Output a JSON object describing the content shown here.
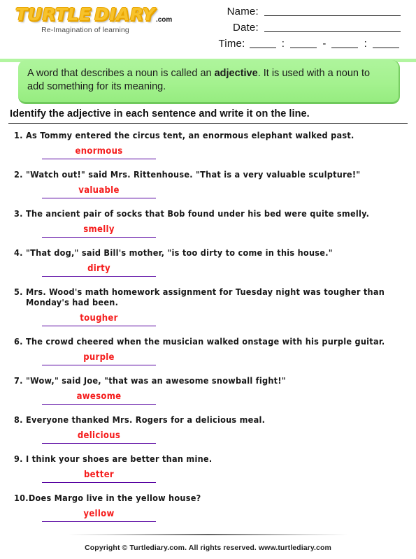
{
  "brand": {
    "logo_word_1": "TURTLE",
    "logo_word_2": "DIARY",
    "logo_dotcom": ".com",
    "tagline": "Re-Imagination of learning",
    "accent_yellow": "#F7C22B"
  },
  "header": {
    "name_label": "Name:",
    "date_label": "Date:",
    "time_label": "Time:",
    "time_sep_colon": ":",
    "time_sep_dash": "-"
  },
  "info": {
    "text_before": "A word that describes a noun is called an ",
    "keyword": "adjective",
    "text_after": ". It is used with a noun to add something for its meaning.",
    "background_color": "#a4f28f"
  },
  "section": {
    "title": "Identify the adjective in each sentence and write it on the line."
  },
  "answers_style": {
    "word_color": "#F51C1C",
    "line_color": "#5500A0"
  },
  "questions": [
    {
      "number": "1.",
      "text": "As Tommy entered the circus tent, an enormous elephant walked past.",
      "answer": "enormous"
    },
    {
      "number": "2.",
      "text": "\"Watch out!\" said Mrs. Rittenhouse. \"That is a very valuable sculpture!\"",
      "answer": "valuable"
    },
    {
      "number": "3.",
      "text": "The ancient pair of socks that Bob found under his bed were quite smelly.",
      "answer": "smelly"
    },
    {
      "number": "4.",
      "text": "\"That dog,\" said Bill's mother, \"is too dirty to come in this house.\"",
      "answer": "dirty"
    },
    {
      "number": "5.",
      "text": "Mrs. Wood's math homework assignment for Tuesday night was tougher than Monday's had been.",
      "answer": "tougher"
    },
    {
      "number": "6.",
      "text": "The crowd cheered when the musician walked onstage with his purple guitar.",
      "answer": "purple"
    },
    {
      "number": "7.",
      "text": "\"Wow,\" said Joe, \"that was an awesome snowball fight!\"",
      "answer": "awesome"
    },
    {
      "number": "8.",
      "text": "Everyone thanked Mrs. Rogers for a delicious meal.",
      "answer": "delicious"
    },
    {
      "number": "9.",
      "text": "I think your shoes are better than mine.",
      "answer": "better"
    },
    {
      "number": "10.",
      "text": "Does Margo live in the yellow house?",
      "answer": "yellow"
    }
  ],
  "footer": {
    "copyright": "Copyright © Turtlediary.com. All rights reserved. www.turtlediary.com"
  }
}
